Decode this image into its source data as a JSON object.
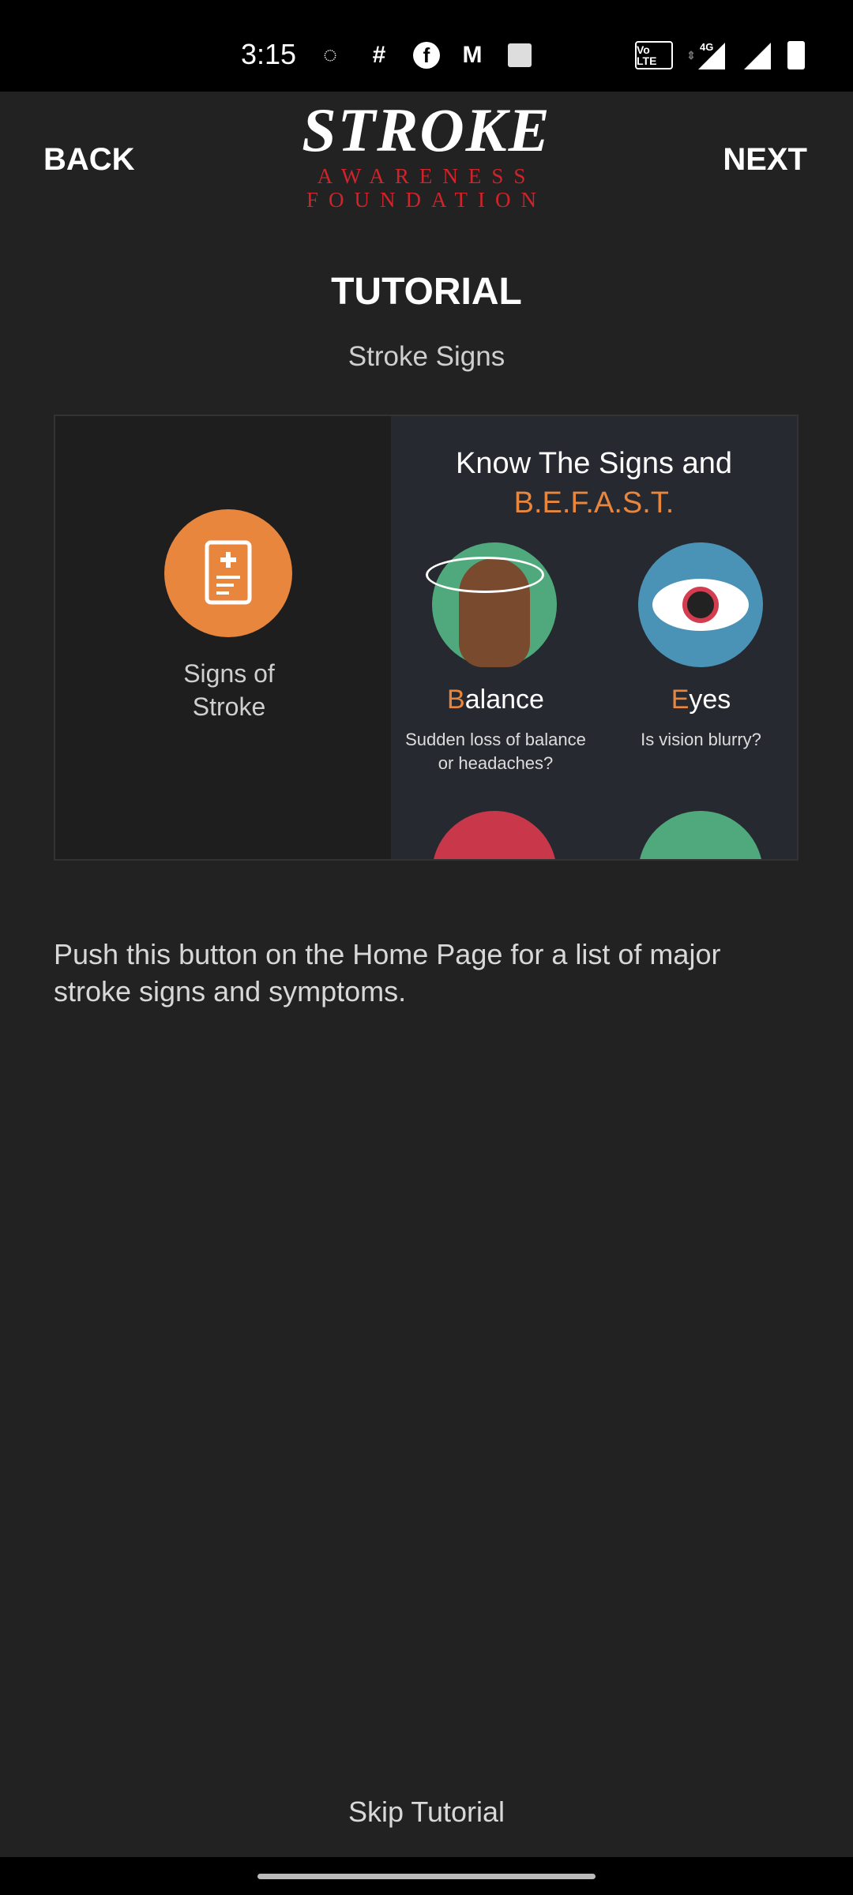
{
  "status_bar": {
    "time": "3:15",
    "notification_icons": [
      "whatsapp-icon",
      "slack-icon",
      "facebook-icon",
      "gmail-icon",
      "gallery-icon"
    ],
    "system_icons": [
      "volte-icon",
      "data-arrows-icon",
      "signal-4g-icon",
      "signal-icon",
      "battery-icon"
    ],
    "network_label": "4G",
    "volte_label": "Vo LTE"
  },
  "header": {
    "back": "BACK",
    "next": "NEXT",
    "logo": {
      "main": "STROKE",
      "line1": "AWARENESS",
      "line2": "FOUNDATION"
    }
  },
  "page": {
    "title": "TUTORIAL",
    "subtitle": "Stroke Signs"
  },
  "preview": {
    "button_label_1": "Signs of",
    "button_label_2": "Stroke",
    "heading": "Know The Signs and",
    "acronym": "B.E.F.A.S.T.",
    "items": [
      {
        "initial": "B",
        "rest": "alance",
        "desc1": "Sudden loss of balance",
        "desc2": "or headaches?"
      },
      {
        "initial": "E",
        "rest": "yes",
        "desc1": "Is vision blurry?",
        "desc2": ""
      }
    ]
  },
  "description": "Push this button on the Home Page for a list of major stroke signs and symptoms.",
  "skip": "Skip Tutorial",
  "colors": {
    "accent_orange": "#e8863e",
    "logo_red": "#d2232a",
    "background": "#222222"
  }
}
